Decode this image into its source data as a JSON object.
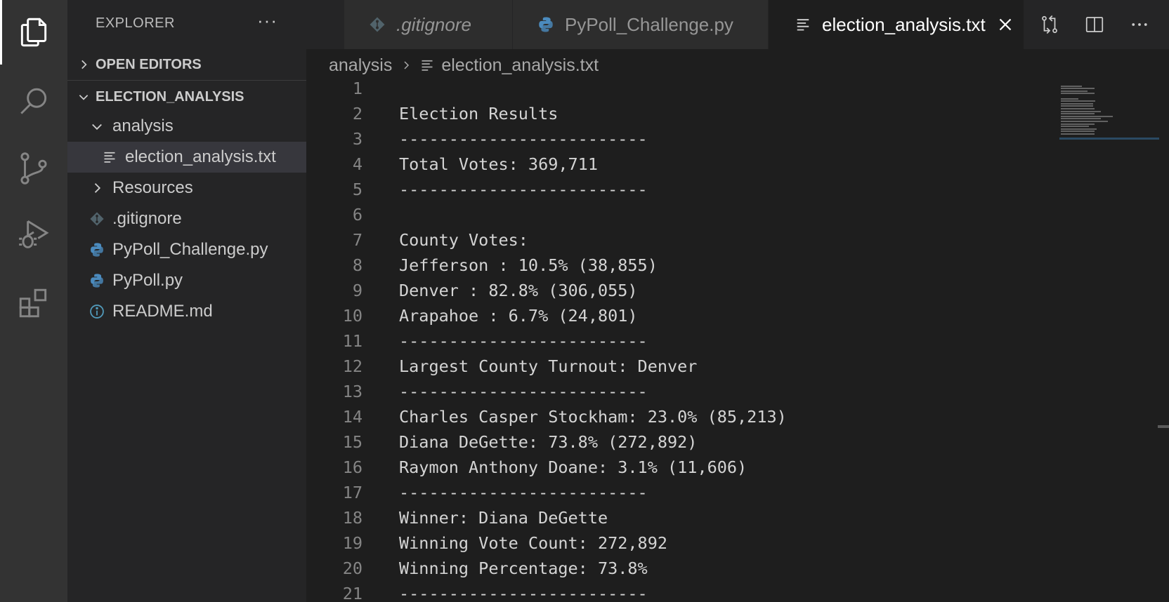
{
  "sidebar": {
    "title": "EXPLORER",
    "more": "···",
    "open_editors": "OPEN EDITORS",
    "project": "ELECTION_ANALYSIS",
    "tree": {
      "analysis": "analysis",
      "election_txt": "election_analysis.txt",
      "resources": "Resources",
      "gitignore": ".gitignore",
      "challenge_py": "PyPoll_Challenge.py",
      "pypoll_py": "PyPoll.py",
      "readme": "README.md"
    }
  },
  "tabs": [
    {
      "label": ".gitignore"
    },
    {
      "label": "PyPoll_Challenge.py"
    },
    {
      "label": "election_analysis.txt"
    }
  ],
  "breadcrumb": {
    "folder": "analysis",
    "file": "election_analysis.txt"
  },
  "editor": {
    "lines": [
      {
        "n": "1",
        "text": ""
      },
      {
        "n": "2",
        "text": "Election Results"
      },
      {
        "n": "3",
        "text": "-------------------------"
      },
      {
        "n": "4",
        "text": "Total Votes: 369,711"
      },
      {
        "n": "5",
        "text": "-------------------------"
      },
      {
        "n": "6",
        "text": ""
      },
      {
        "n": "7",
        "text": "County Votes:"
      },
      {
        "n": "8",
        "text": "Jefferson : 10.5% (38,855)"
      },
      {
        "n": "9",
        "text": "Denver : 82.8% (306,055)"
      },
      {
        "n": "10",
        "text": "Arapahoe : 6.7% (24,801)"
      },
      {
        "n": "11",
        "text": "-------------------------"
      },
      {
        "n": "12",
        "text": "Largest County Turnout: Denver"
      },
      {
        "n": "13",
        "text": "-------------------------"
      },
      {
        "n": "14",
        "text": "Charles Casper Stockham: 23.0% (85,213)"
      },
      {
        "n": "15",
        "text": "Diana DeGette: 73.8% (272,892)"
      },
      {
        "n": "16",
        "text": "Raymon Anthony Doane: 3.1% (11,606)"
      },
      {
        "n": "17",
        "text": "-------------------------"
      },
      {
        "n": "18",
        "text": "Winner: Diana DeGette"
      },
      {
        "n": "19",
        "text": "Winning Vote Count: 272,892"
      },
      {
        "n": "20",
        "text": "Winning Percentage: 73.8%"
      },
      {
        "n": "21",
        "text": "-------------------------"
      }
    ]
  },
  "colors": {
    "accent": "#ffffff",
    "python": "#4b8bbe",
    "git": "#51636b",
    "info": "#519aba"
  }
}
